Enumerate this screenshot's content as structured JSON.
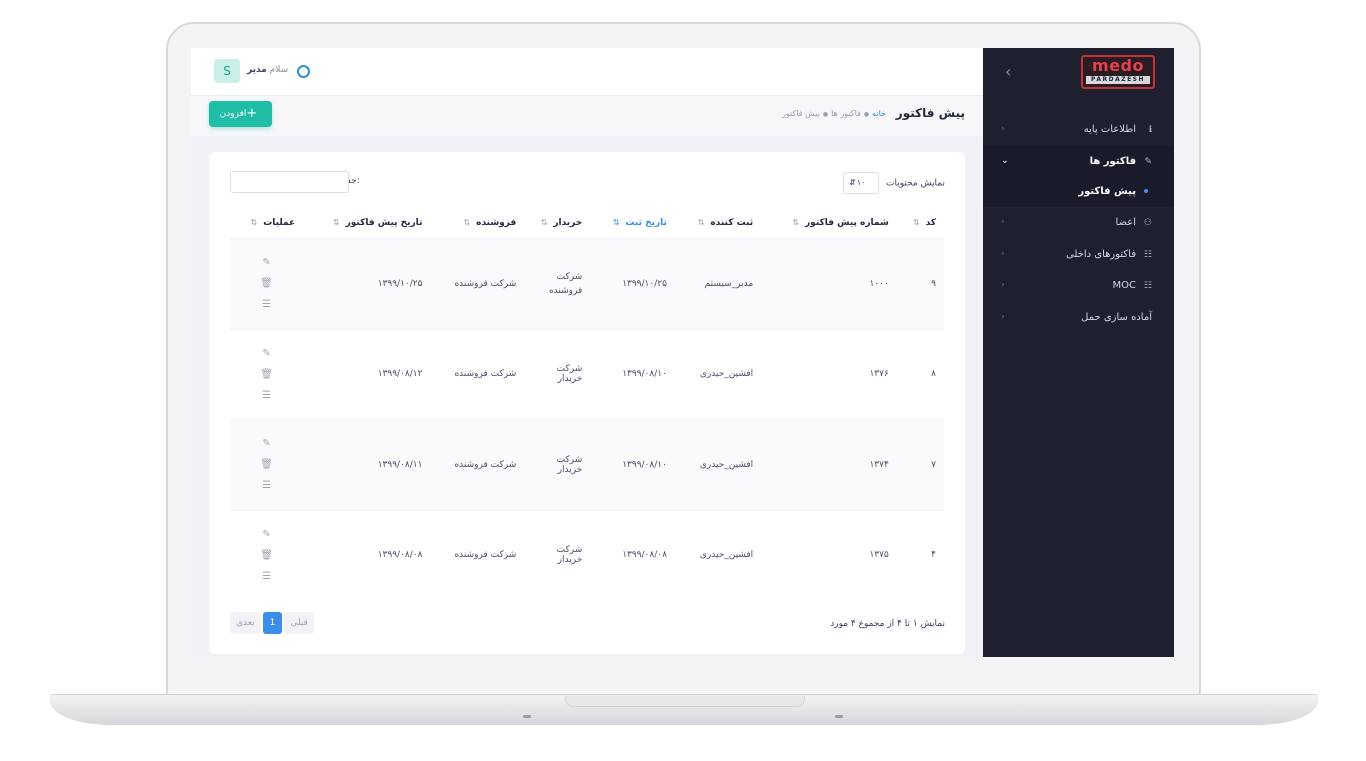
{
  "sidebar": {
    "logo": {
      "word": "medo",
      "sub": "PARDAZESH"
    },
    "items": [
      {
        "label": "اطلاعات پایه",
        "icon": "info-icon"
      },
      {
        "label": "فاکتور ها",
        "icon": "edit-icon"
      },
      {
        "label": "اعضا",
        "icon": "users-icon"
      },
      {
        "label": "فاکتورهای داخلی",
        "icon": "document-icon"
      },
      {
        "label": "MOC",
        "icon": "document-icon"
      },
      {
        "label": "آماده سازی حمل",
        "icon": ""
      }
    ],
    "sub_items": [
      {
        "label": "پیش فاکتور"
      }
    ]
  },
  "header": {
    "avatar_letter": "S",
    "greeting_prefix": "سلام",
    "greeting_name": "مدیر"
  },
  "titlebar": {
    "title": "پیش فاکتور",
    "breadcrumb": [
      "خانه",
      "فاکتور ها",
      "پیش فاکتور"
    ],
    "add_label": "افزودن"
  },
  "table_controls": {
    "show_label": "نمایش محتویات",
    "page_size": "۱۰",
    "search_label": "جستجو:"
  },
  "table": {
    "columns": [
      "کد",
      "شماره پیش فاکتور",
      "ثبت کننده",
      "تاریخ ثبت",
      "خریدار",
      "فروشنده",
      "تاریخ پیش فاکتور",
      "عملیات"
    ],
    "rows": [
      {
        "code": "۹",
        "number": "۱۰۰۰",
        "creator": "مدیر_سیستم",
        "date": "۱۳۹۹/۱۰/۲۵",
        "buyer": "شرکت فروشنده",
        "seller": "شرکت فروشنده",
        "invoice_date": "۱۳۹۹/۱۰/۲۵"
      },
      {
        "code": "۸",
        "number": "۱۳۷۶",
        "creator": "افشین_حیدری",
        "date": "۱۳۹۹/۰۸/۱۰",
        "buyer": "شرکت خریدار",
        "seller": "شرکت فروشنده",
        "invoice_date": "۱۳۹۹/۰۸/۱۲"
      },
      {
        "code": "۷",
        "number": "۱۳۷۴",
        "creator": "افشین_حیدری",
        "date": "۱۳۹۹/۰۸/۱۰",
        "buyer": "شرکت خریدار",
        "seller": "شرکت فروشنده",
        "invoice_date": "۱۳۹۹/۰۸/۱۱"
      },
      {
        "code": "۴",
        "number": "۱۳۷۵",
        "creator": "افشین_حیدری",
        "date": "۱۳۹۹/۰۸/۰۸",
        "buyer": "شرکت خریدار",
        "seller": "شرکت فروشنده",
        "invoice_date": "۱۳۹۹/۰۸/۰۸"
      }
    ],
    "ops_icons": [
      "edit-icon",
      "trash-icon",
      "list-icon"
    ]
  },
  "footer": {
    "info": "نمایش ۱ تا ۴ از مجموع ۴ مورد",
    "prev": "قبلی",
    "current_page": "1",
    "next": "بعدی"
  },
  "colors": {
    "accent": "#1fbca6",
    "link": "#3a8ee8",
    "sidebar": "#1e2030",
    "logo": "#e2434c"
  }
}
